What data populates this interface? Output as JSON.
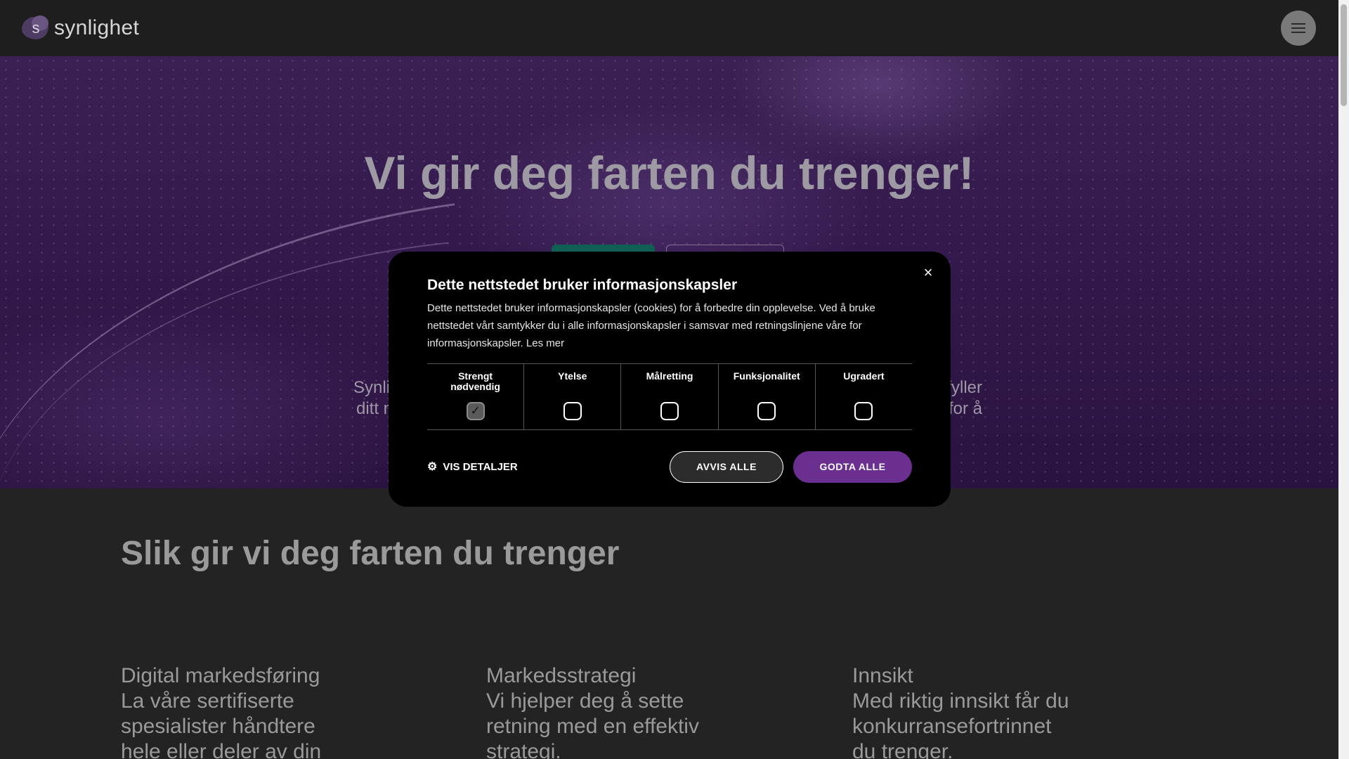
{
  "header": {
    "logo_text": "synlighet",
    "logo_mark_letter": "s",
    "menu_icon": "hamburger-menu-icon"
  },
  "hero": {
    "title": "Vi gir deg farten du trenger!",
    "partial_text_left": [
      "Synli",
      "ditt n"
    ],
    "partial_text_right": [
      "fyller",
      "for å"
    ]
  },
  "section": {
    "title": "Slik gir vi deg farten du trenger",
    "columns": [
      {
        "title": "Digital markedsføring",
        "lines": [
          "La våre sertifiserte",
          "spesialister håndtere",
          "hele eller deler av din"
        ]
      },
      {
        "title": "Markedsstrategi",
        "lines": [
          "Vi hjelper deg å sette",
          "retning med en effektiv",
          "strategi."
        ]
      },
      {
        "title": "Innsikt",
        "lines": [
          "Med riktig innsikt får du",
          "konkurransefortrinnet",
          "du trenger."
        ]
      }
    ]
  },
  "cookie_modal": {
    "close_icon": "×",
    "title": "Dette nettstedet bruker informasjonskapsler",
    "body": "Dette nettstedet bruker informasjonskapsler (cookies) for å forbedre din opplevelse. Ved å bruke nettstedet vårt samtykker du i alle informasjonskapsler i samsvar med retningslinjene våre for informasjonskapsler.",
    "read_more": "Les mer",
    "categories": [
      {
        "label": "Strengt nødvendig",
        "checked": true
      },
      {
        "label": "Ytelse",
        "checked": false
      },
      {
        "label": "Målretting",
        "checked": false
      },
      {
        "label": "Funksjonalitet",
        "checked": false
      },
      {
        "label": "Ugradert",
        "checked": false
      }
    ],
    "details_label": "VIS DETALJER",
    "reject_label": "AVVIS ALLE",
    "accept_label": "GODTA ALLE",
    "accept_color": "#6b2f8f"
  }
}
